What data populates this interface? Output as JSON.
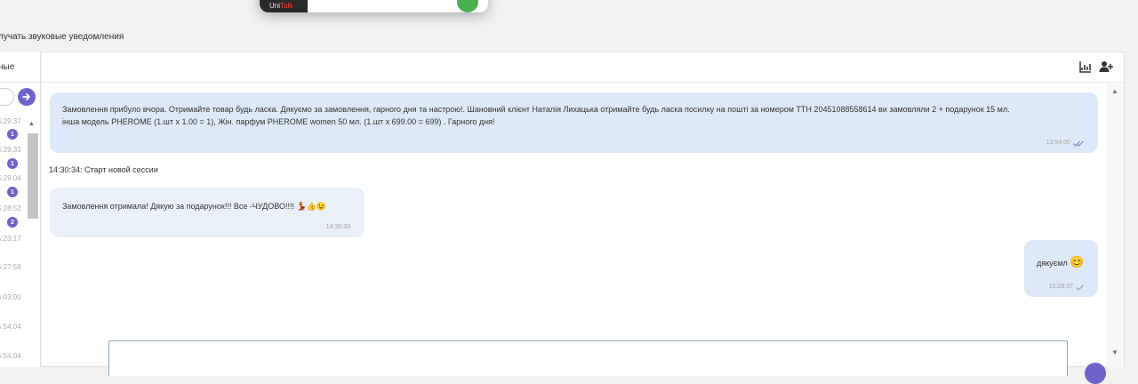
{
  "popup": {
    "brand_main": "Uni",
    "brand_accent": "Talk"
  },
  "settings": {
    "sound_label": "лучать звуковые уведомления"
  },
  "left": {
    "title": "ные",
    "dialogs": [
      {
        "time": "5:29:37",
        "badge": "1"
      },
      {
        "time": "5:29:33",
        "badge": "1"
      },
      {
        "time": "5:29:04",
        "badge": "1"
      },
      {
        "time": "5:28:52",
        "badge": "2"
      },
      {
        "time": "5:23:17",
        "badge": ""
      },
      {
        "time": "5:27:58",
        "badge": ""
      },
      {
        "time": "5:03:00",
        "badge": ""
      },
      {
        "time": "5:54:04",
        "badge": ""
      },
      {
        "time": "5:54:04",
        "badge": ""
      }
    ]
  },
  "chat": {
    "messages": [
      {
        "line1": "Замовлення прибуло вчора. Отримайте товар будь ласка. Дякуємо за замовлення, гарного дня та настрою!.  Шановний клієнт Наталія Лихацька отримайте будь ласка посилку на пошті за номером ТТН 20451088558614 ви замовляли 2 + подарунок 15 мл.",
        "line2": "інша модель PHEROME (1.шт x 1.00 = 1), Жін. парфум PHEROME women 50 мл. (1.шт x 699.00 = 699) . Гарного дня!",
        "time": "13:54:00"
      },
      {
        "text": "Замовлення отримала! Дякую за подарунок!!! Все -ЧУДОВО!!!!",
        "emoji": "💃👍😉",
        "time": "14:30:33"
      },
      {
        "text": "дякуємл",
        "emoji": "😊",
        "time": "15:29:37"
      }
    ],
    "session_notice": "14:30:34: Старт новой сессии"
  },
  "colors": {
    "accent": "#6e63c9",
    "out_bubble": "#dde9f8",
    "in_bubble": "#eaf0f7",
    "check": "#7b8ec8"
  }
}
